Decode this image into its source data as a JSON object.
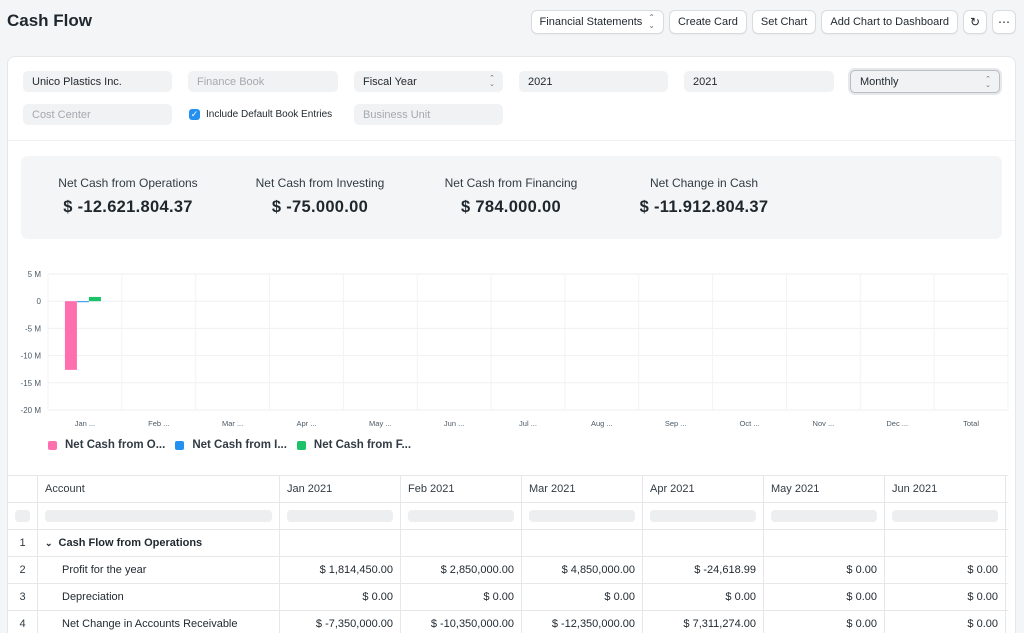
{
  "page": {
    "title": "Cash Flow"
  },
  "toolbar": {
    "report_select": "Financial Statements",
    "create_card": "Create Card",
    "set_chart": "Set Chart",
    "add_chart": "Add Chart to Dashboard",
    "refresh_icon": "refresh-icon",
    "more_icon": "more-icon",
    "refresh_glyph": "↻",
    "more_glyph": "⋯"
  },
  "filters": {
    "company": "Unico Plastics Inc.",
    "finance_book": {
      "value": "",
      "placeholder": "Finance Book"
    },
    "period_type": "Fiscal Year",
    "from_year": "2021",
    "to_year": "2021",
    "periodicity": "Monthly",
    "cost_center": {
      "value": "",
      "placeholder": "Cost Center"
    },
    "include_default_book": {
      "label": "Include Default Book Entries",
      "checked": true
    },
    "business_unit": {
      "value": "",
      "placeholder": "Business Unit"
    }
  },
  "summary": [
    {
      "label": "Net Cash from Operations",
      "value": "$ -12.621.804.37"
    },
    {
      "label": "Net Cash from Investing",
      "value": "$ -75.000.00"
    },
    {
      "label": "Net Cash from Financing",
      "value": "$ 784.000.00"
    },
    {
      "label": "Net Change in Cash",
      "value": "$ -11.912.804.37"
    }
  ],
  "chart_data": {
    "type": "bar",
    "categories": [
      "Jan ...",
      "Feb ...",
      "Mar ...",
      "Apr ...",
      "May ...",
      "Jun ...",
      "Jul ...",
      "Aug ...",
      "Sep ...",
      "Oct ...",
      "Nov ...",
      "Dec ...",
      "Total"
    ],
    "y_ticks": [
      "5 M",
      "0",
      "-5 M",
      "-10 M",
      "-15 M",
      "-20 M"
    ],
    "y_tick_values": [
      5000000,
      0,
      -5000000,
      -10000000,
      -15000000,
      -20000000
    ],
    "ylim": [
      -20000000,
      5000000
    ],
    "series": [
      {
        "name": "Net Cash from O...",
        "color": "#ff6fae",
        "values": [
          -12621804.37,
          0,
          0,
          0,
          0,
          0,
          0,
          0,
          0,
          0,
          0,
          0,
          0
        ]
      },
      {
        "name": "Net Cash from I...",
        "color": "#2490ef",
        "values": [
          -75000,
          0,
          0,
          0,
          0,
          0,
          0,
          0,
          0,
          0,
          0,
          0,
          0
        ]
      },
      {
        "name": "Net Cash from F...",
        "color": "#1bc269",
        "values": [
          784000,
          0,
          0,
          0,
          0,
          0,
          0,
          0,
          0,
          0,
          0,
          0,
          0
        ]
      }
    ],
    "legend_position": "bottom-left",
    "grid": true
  },
  "table": {
    "columns": [
      "Account",
      "Jan 2021",
      "Feb 2021",
      "Mar 2021",
      "Apr 2021",
      "May 2021",
      "Jun 2021"
    ],
    "rows": [
      {
        "num": "1",
        "account": "Cash Flow from Operations",
        "group": true,
        "values": [
          "",
          "",
          "",
          "",
          "",
          ""
        ]
      },
      {
        "num": "2",
        "account": "Profit for the year",
        "values": [
          "$ 1,814,450.00",
          "$ 2,850,000.00",
          "$ 4,850,000.00",
          "$ -24,618.99",
          "$ 0.00",
          "$ 0.00"
        ]
      },
      {
        "num": "3",
        "account": "Depreciation",
        "values": [
          "$ 0.00",
          "$ 0.00",
          "$ 0.00",
          "$ 0.00",
          "$ 0.00",
          "$ 0.00"
        ]
      },
      {
        "num": "4",
        "account": "Net Change in Accounts Receivable",
        "values": [
          "$ -7,350,000.00",
          "$ -10,350,000.00",
          "$ -12,350,000.00",
          "$ 7,311,274.00",
          "$ 0.00",
          "$ 0.00"
        ]
      }
    ]
  }
}
